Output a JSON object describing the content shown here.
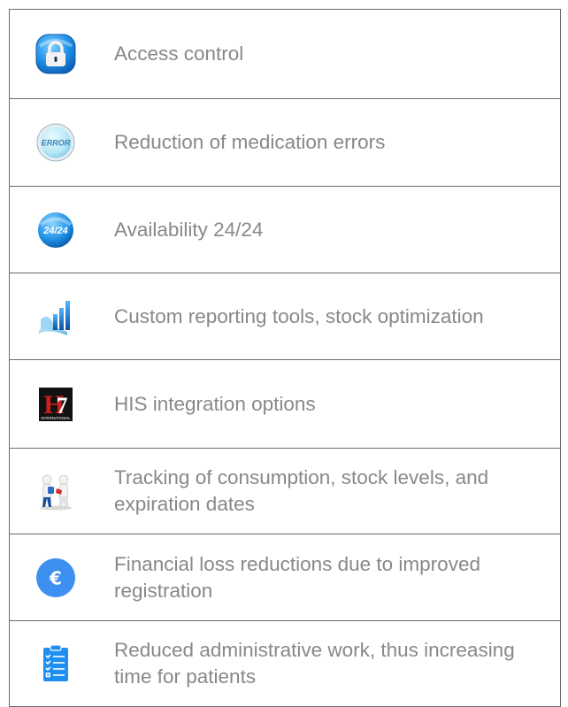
{
  "features": [
    {
      "icon": "padlock-icon",
      "label": "Access control"
    },
    {
      "icon": "error-icon",
      "label": "Reduction of medication errors",
      "icon_text": "ERROR"
    },
    {
      "icon": "availability-24-icon",
      "label": "Availability 24/24",
      "icon_text": "24/24"
    },
    {
      "icon": "bar-chart-icon",
      "label": "Custom reporting tools, stock optimization"
    },
    {
      "icon": "hl7-logo-icon",
      "label": "HIS integration options",
      "icon_text": "HL7 INTERNATIONAL"
    },
    {
      "icon": "tracking-figures-icon",
      "label": "Tracking of consumption, stock levels, and expiration dates"
    },
    {
      "icon": "euro-icon",
      "label": "Financial loss reductions due to improved registration",
      "icon_text": "€"
    },
    {
      "icon": "checklist-clipboard-icon",
      "label": "Reduced administrative work, thus increasing time for patients"
    }
  ],
  "colors": {
    "text": "#888888",
    "border": "#6b6b6b",
    "icon_blue": "#1e90e8",
    "euro_blue": "#3d8ff0"
  }
}
